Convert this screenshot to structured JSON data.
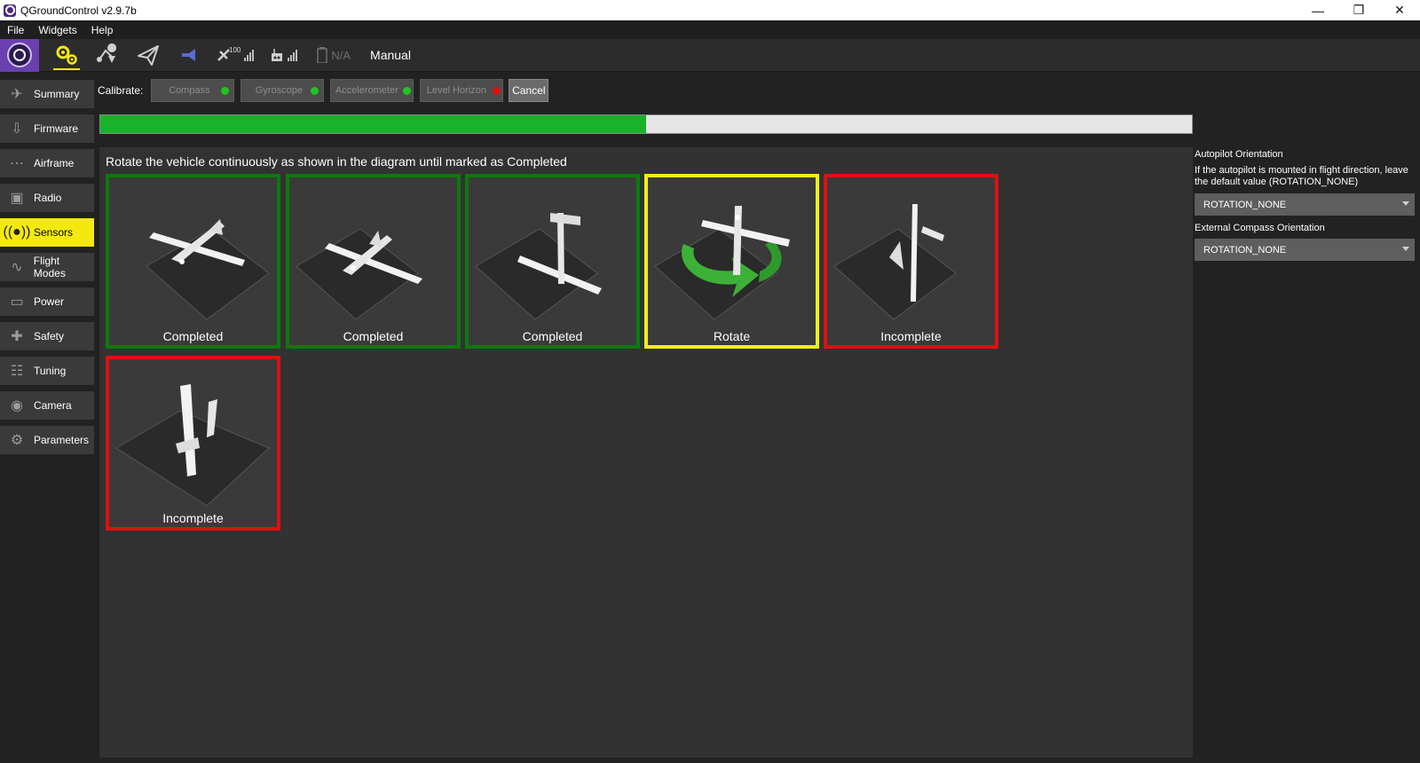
{
  "window": {
    "title": "QGroundControl v2.9.7b"
  },
  "menu": [
    "File",
    "Widgets",
    "Help"
  ],
  "toolbar": {
    "gps_count": "100",
    "battery": "N/A",
    "flight_mode": "Manual"
  },
  "sidebar": {
    "items": [
      {
        "label": "Summary",
        "icon": "plane-icon"
      },
      {
        "label": "Firmware",
        "icon": "download-icon"
      },
      {
        "label": "Airframe",
        "icon": "airframe-icon"
      },
      {
        "label": "Radio",
        "icon": "radio-icon"
      },
      {
        "label": "Sensors",
        "icon": "sensors-icon"
      },
      {
        "label": "Flight Modes",
        "icon": "wave-icon"
      },
      {
        "label": "Power",
        "icon": "battery-icon"
      },
      {
        "label": "Safety",
        "icon": "safety-icon"
      },
      {
        "label": "Tuning",
        "icon": "sliders-icon"
      },
      {
        "label": "Camera",
        "icon": "camera-icon"
      },
      {
        "label": "Parameters",
        "icon": "gears-icon"
      }
    ],
    "active": "Sensors"
  },
  "calibrate": {
    "label": "Calibrate:",
    "buttons": [
      {
        "label": "Compass",
        "status_color": "#22c41f"
      },
      {
        "label": "Gyroscope",
        "status_color": "#22c41f"
      },
      {
        "label": "Accelerometer",
        "status_color": "#22c41f"
      },
      {
        "label": "Level Horizon",
        "status_color": "#e01010"
      }
    ],
    "cancel": "Cancel"
  },
  "progress": {
    "fraction": 0.5
  },
  "main": {
    "instruction": "Rotate the vehicle continuously as shown in the diagram until marked as Completed",
    "tiles": [
      {
        "label": "Completed",
        "border": "#0b7a0b"
      },
      {
        "label": "Completed",
        "border": "#0b7a0b"
      },
      {
        "label": "Completed",
        "border": "#0b7a0b"
      },
      {
        "label": "Rotate",
        "border": "#f2ef14"
      },
      {
        "label": "Incomplete",
        "border": "#e10f0f"
      },
      {
        "label": "Incomplete",
        "border": "#e10f0f"
      }
    ]
  },
  "right": {
    "autopilot_heading": "Autopilot Orientation",
    "autopilot_desc": "If the autopilot is mounted in flight direction, leave the default value (ROTATION_NONE)",
    "autopilot_value": "ROTATION_NONE",
    "compass_heading": "External Compass Orientation",
    "compass_value": "ROTATION_NONE"
  },
  "colors": {
    "accent": "#f4e90f",
    "progress": "#1ab22a"
  }
}
